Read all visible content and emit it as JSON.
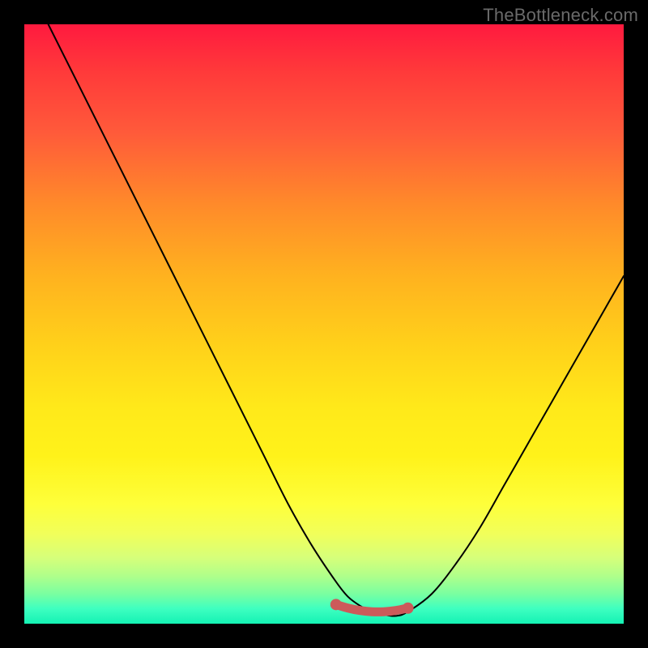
{
  "watermark": "TheBottleneck.com",
  "colors": {
    "frame": "#000000",
    "curve_stroke": "#000000",
    "marker_stroke": "#cc5a5a",
    "marker_fill": "#cc5a5a"
  },
  "chart_data": {
    "type": "line",
    "title": "",
    "xlabel": "",
    "ylabel": "",
    "xlim": [
      0,
      100
    ],
    "ylim": [
      0,
      100
    ],
    "grid": false,
    "series": [
      {
        "name": "bottleneck-curve",
        "x": [
          4,
          8,
          12,
          16,
          20,
          24,
          28,
          32,
          36,
          40,
          44,
          48,
          52,
          54,
          56,
          58,
          60,
          62,
          64,
          68,
          72,
          76,
          80,
          84,
          88,
          92,
          96,
          100
        ],
        "y": [
          100,
          92,
          84,
          76,
          68,
          60,
          52,
          44,
          36,
          28,
          20,
          13,
          7,
          4.5,
          3,
          2,
          1.5,
          1.3,
          2,
          5,
          10,
          16,
          23,
          30,
          37,
          44,
          51,
          58
        ]
      }
    ],
    "highlighted_segment": {
      "name": "valley-marker",
      "x": [
        52,
        54,
        56,
        58,
        60,
        62,
        64
      ],
      "y": [
        3.2,
        2.6,
        2.2,
        2.0,
        2.0,
        2.2,
        2.6
      ]
    }
  }
}
